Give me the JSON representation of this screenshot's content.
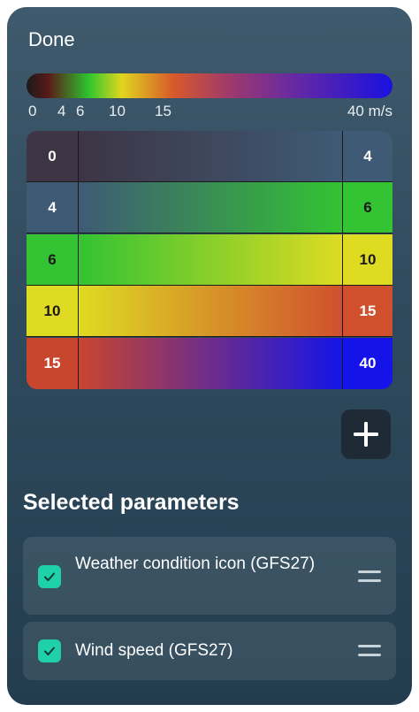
{
  "header": {
    "done_label": "Done"
  },
  "scale": {
    "gradient_colors": [
      "#1a1a1a",
      "#5a1a1a",
      "#2ec52e",
      "#e0d61e",
      "#d85a2a",
      "#a03a6a",
      "#6a2aa0",
      "#1a10e0"
    ],
    "labels": [
      "0",
      "4",
      "6",
      "10",
      "15",
      "40 m/s"
    ]
  },
  "ranges": [
    {
      "from": "0",
      "to": "4",
      "from_color": "#3d3545",
      "to_color": "#3f5a75"
    },
    {
      "from": "4",
      "to": "6",
      "from_color": "#3f5a75",
      "to_color": "#33c333"
    },
    {
      "from": "6",
      "to": "10",
      "from_color": "#33c333",
      "to_color": "#dedb22"
    },
    {
      "from": "10",
      "to": "15",
      "from_color": "#dedb22",
      "to_color": "#d0502e"
    },
    {
      "from": "15",
      "to": "40",
      "from_color": "#c8452e",
      "to_color": "#1414e8"
    }
  ],
  "add_button": {
    "icon": "plus-icon"
  },
  "selected_section": {
    "title": "Selected parameters",
    "items": [
      {
        "label": "Weather condition icon (GFS27)",
        "checked": true
      },
      {
        "label": "Wind speed (GFS27)",
        "checked": true
      }
    ]
  }
}
